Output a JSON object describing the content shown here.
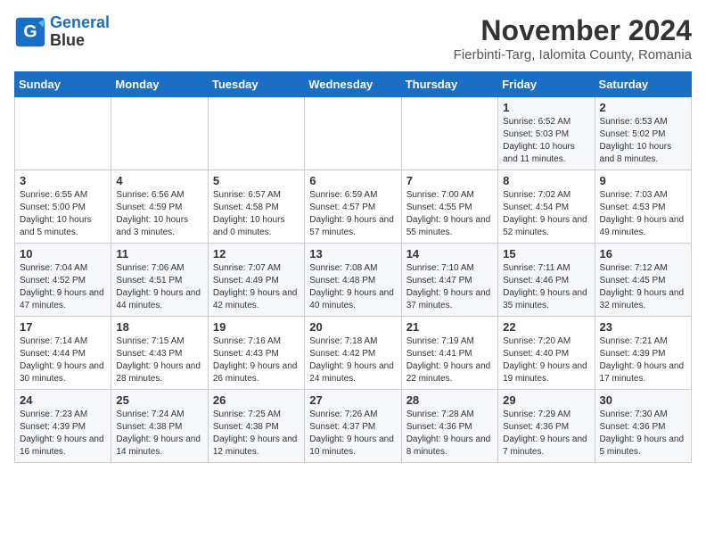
{
  "header": {
    "logo_line1": "General",
    "logo_line2": "Blue",
    "title": "November 2024",
    "subtitle": "Fierbinti-Targ, Ialomita County, Romania"
  },
  "days_of_week": [
    "Sunday",
    "Monday",
    "Tuesday",
    "Wednesday",
    "Thursday",
    "Friday",
    "Saturday"
  ],
  "weeks": [
    [
      {
        "day": "",
        "info": ""
      },
      {
        "day": "",
        "info": ""
      },
      {
        "day": "",
        "info": ""
      },
      {
        "day": "",
        "info": ""
      },
      {
        "day": "",
        "info": ""
      },
      {
        "day": "1",
        "info": "Sunrise: 6:52 AM\nSunset: 5:03 PM\nDaylight: 10 hours and 11 minutes."
      },
      {
        "day": "2",
        "info": "Sunrise: 6:53 AM\nSunset: 5:02 PM\nDaylight: 10 hours and 8 minutes."
      }
    ],
    [
      {
        "day": "3",
        "info": "Sunrise: 6:55 AM\nSunset: 5:00 PM\nDaylight: 10 hours and 5 minutes."
      },
      {
        "day": "4",
        "info": "Sunrise: 6:56 AM\nSunset: 4:59 PM\nDaylight: 10 hours and 3 minutes."
      },
      {
        "day": "5",
        "info": "Sunrise: 6:57 AM\nSunset: 4:58 PM\nDaylight: 10 hours and 0 minutes."
      },
      {
        "day": "6",
        "info": "Sunrise: 6:59 AM\nSunset: 4:57 PM\nDaylight: 9 hours and 57 minutes."
      },
      {
        "day": "7",
        "info": "Sunrise: 7:00 AM\nSunset: 4:55 PM\nDaylight: 9 hours and 55 minutes."
      },
      {
        "day": "8",
        "info": "Sunrise: 7:02 AM\nSunset: 4:54 PM\nDaylight: 9 hours and 52 minutes."
      },
      {
        "day": "9",
        "info": "Sunrise: 7:03 AM\nSunset: 4:53 PM\nDaylight: 9 hours and 49 minutes."
      }
    ],
    [
      {
        "day": "10",
        "info": "Sunrise: 7:04 AM\nSunset: 4:52 PM\nDaylight: 9 hours and 47 minutes."
      },
      {
        "day": "11",
        "info": "Sunrise: 7:06 AM\nSunset: 4:51 PM\nDaylight: 9 hours and 44 minutes."
      },
      {
        "day": "12",
        "info": "Sunrise: 7:07 AM\nSunset: 4:49 PM\nDaylight: 9 hours and 42 minutes."
      },
      {
        "day": "13",
        "info": "Sunrise: 7:08 AM\nSunset: 4:48 PM\nDaylight: 9 hours and 40 minutes."
      },
      {
        "day": "14",
        "info": "Sunrise: 7:10 AM\nSunset: 4:47 PM\nDaylight: 9 hours and 37 minutes."
      },
      {
        "day": "15",
        "info": "Sunrise: 7:11 AM\nSunset: 4:46 PM\nDaylight: 9 hours and 35 minutes."
      },
      {
        "day": "16",
        "info": "Sunrise: 7:12 AM\nSunset: 4:45 PM\nDaylight: 9 hours and 32 minutes."
      }
    ],
    [
      {
        "day": "17",
        "info": "Sunrise: 7:14 AM\nSunset: 4:44 PM\nDaylight: 9 hours and 30 minutes."
      },
      {
        "day": "18",
        "info": "Sunrise: 7:15 AM\nSunset: 4:43 PM\nDaylight: 9 hours and 28 minutes."
      },
      {
        "day": "19",
        "info": "Sunrise: 7:16 AM\nSunset: 4:43 PM\nDaylight: 9 hours and 26 minutes."
      },
      {
        "day": "20",
        "info": "Sunrise: 7:18 AM\nSunset: 4:42 PM\nDaylight: 9 hours and 24 minutes."
      },
      {
        "day": "21",
        "info": "Sunrise: 7:19 AM\nSunset: 4:41 PM\nDaylight: 9 hours and 22 minutes."
      },
      {
        "day": "22",
        "info": "Sunrise: 7:20 AM\nSunset: 4:40 PM\nDaylight: 9 hours and 19 minutes."
      },
      {
        "day": "23",
        "info": "Sunrise: 7:21 AM\nSunset: 4:39 PM\nDaylight: 9 hours and 17 minutes."
      }
    ],
    [
      {
        "day": "24",
        "info": "Sunrise: 7:23 AM\nSunset: 4:39 PM\nDaylight: 9 hours and 16 minutes."
      },
      {
        "day": "25",
        "info": "Sunrise: 7:24 AM\nSunset: 4:38 PM\nDaylight: 9 hours and 14 minutes."
      },
      {
        "day": "26",
        "info": "Sunrise: 7:25 AM\nSunset: 4:38 PM\nDaylight: 9 hours and 12 minutes."
      },
      {
        "day": "27",
        "info": "Sunrise: 7:26 AM\nSunset: 4:37 PM\nDaylight: 9 hours and 10 minutes."
      },
      {
        "day": "28",
        "info": "Sunrise: 7:28 AM\nSunset: 4:36 PM\nDaylight: 9 hours and 8 minutes."
      },
      {
        "day": "29",
        "info": "Sunrise: 7:29 AM\nSunset: 4:36 PM\nDaylight: 9 hours and 7 minutes."
      },
      {
        "day": "30",
        "info": "Sunrise: 7:30 AM\nSunset: 4:36 PM\nDaylight: 9 hours and 5 minutes."
      }
    ]
  ]
}
